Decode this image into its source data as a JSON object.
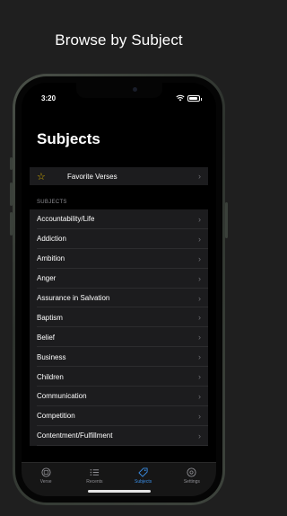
{
  "headline": "Browse by Subject",
  "status_bar": {
    "time": "3:20"
  },
  "title": "Subjects",
  "favorite": {
    "label": "Favorite Verses",
    "icon": "star-outline-icon"
  },
  "section_header": "SUBJECTS",
  "subjects": [
    "Accountability/Life",
    "Addiction",
    "Ambition",
    "Anger",
    "Assurance in Salvation",
    "Baptism",
    "Belief",
    "Business",
    "Children",
    "Communication",
    "Competition",
    "Contentment/Fulfillment"
  ],
  "tabs": [
    {
      "label": "Verse",
      "icon": "verse-icon",
      "active": false
    },
    {
      "label": "Recents",
      "icon": "list-icon",
      "active": false
    },
    {
      "label": "Subjects",
      "icon": "tag-icon",
      "active": true
    },
    {
      "label": "Settings",
      "icon": "gear-icon",
      "active": false
    }
  ],
  "colors": {
    "accent": "#3a8ee6",
    "star": "#d9b100",
    "cell": "#1c1c1e",
    "background": "#000000"
  }
}
